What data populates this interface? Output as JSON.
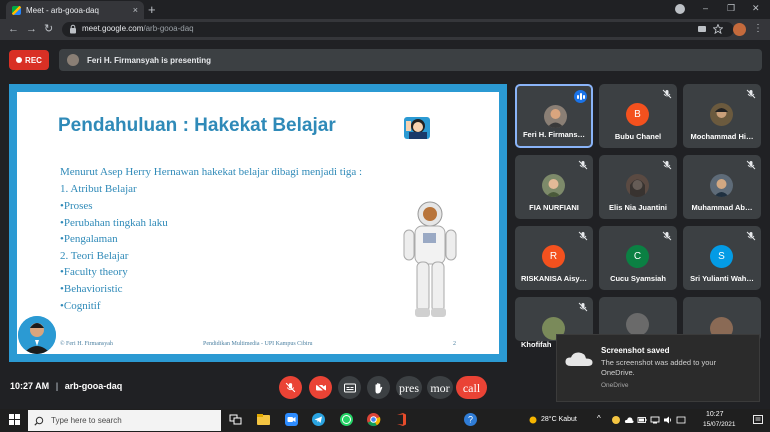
{
  "browser": {
    "tab_title": "Meet - arb-gooa-daq",
    "tab_close": "×",
    "new_tab": "+",
    "url_host": "meet.google.com",
    "url_path": "/arb-gooa-daq",
    "controls": {
      "minimize": "–",
      "maximize": "❐",
      "close": "✕"
    },
    "nav": {
      "back": "←",
      "forward": "→",
      "reload": "↻"
    }
  },
  "meet": {
    "rec_label": "REC",
    "presenting_text": "Feri H. Firmansyah is presenting",
    "meeting_time": "10:27 AM",
    "separator": "|",
    "meeting_code": "arb-gooa-daq",
    "overlay_texts": [
      "pres",
      "mor",
      "call"
    ]
  },
  "slide": {
    "title": "Pendahuluan : Hakekat Belajar",
    "intro": "Menurut Asep Herry Hernawan hakekat belajar dibagi menjadi tiga :",
    "items": [
      "1.  Atribut Belajar",
      "•Proses",
      "•Perubahan tingkah laku",
      "•Pengalaman",
      "2.  Teori Belajar",
      "•Faculty theory",
      "•Behavioristic",
      "•Cognitif"
    ],
    "footer_left": "© Feri H. Firmansyah",
    "footer_center": "Pendidikan Multimedia - UPI Kampus Cibiru",
    "page_number": "2"
  },
  "participants": [
    {
      "name": "Feri H. Firmans…",
      "initial": "",
      "color": "#8a7f75",
      "speaking": true
    },
    {
      "name": "Bubu Chanel",
      "initial": "B",
      "color": "#f4511e",
      "speaking": false
    },
    {
      "name": "Mochammad Hi…",
      "initial": "",
      "color": "#6b5a3e",
      "speaking": false
    },
    {
      "name": "FIA NURFIANI",
      "initial": "",
      "color": "#7d8a6a",
      "speaking": false
    },
    {
      "name": "Elis Nia Juantini",
      "initial": "",
      "color": "#5a4a42",
      "speaking": false
    },
    {
      "name": "Muhammad Ab…",
      "initial": "",
      "color": "#5e6b78",
      "speaking": false
    },
    {
      "name": "RISKANISA Aisy…",
      "initial": "R",
      "color": "#f4511e",
      "speaking": false
    },
    {
      "name": "Cucu Syamsiah",
      "initial": "C",
      "color": "#0b8043",
      "speaking": false
    },
    {
      "name": "Sri Yulianti Wah…",
      "initial": "S",
      "color": "#039be5",
      "speaking": false
    },
    {
      "name": "Khofifah",
      "initial": "",
      "color": "#7a8a5a",
      "speaking": false
    },
    {
      "name": "",
      "initial": "",
      "color": "#6a6a6a",
      "speaking": false
    },
    {
      "name": "",
      "initial": "",
      "color": "#8a6a55",
      "speaking": false
    }
  ],
  "toast": {
    "title": "Screenshot saved",
    "body": "The screenshot was added to your OneDrive.",
    "source": "OneDrive"
  },
  "taskbar": {
    "search_placeholder": "Type here to search",
    "weather": "28°C  Kabut",
    "clock_time": "10:27",
    "clock_date": "15/07/2021"
  },
  "colors": {
    "slide_blue": "#2b9ad3",
    "rec_red": "#d93025",
    "control_red": "#ea4335",
    "active_border": "#8ab4f8"
  }
}
